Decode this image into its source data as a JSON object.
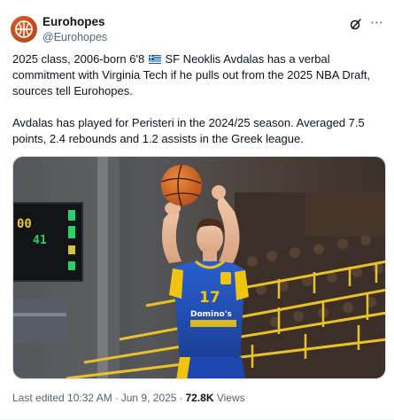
{
  "account": {
    "display_name": "Eurohopes",
    "handle": "@Eurohopes"
  },
  "icons": {
    "avatar": "basketball-logo",
    "grok": "grok-icon",
    "more": "more-options-icon"
  },
  "tweet": {
    "line1_before_flag": "2025 class, 2006-born 6'8",
    "line1_after_flag": "SF Neoklis Avdalas has a verbal commitment with Virginia Tech if he pulls out from the 2025 NBA Draft, sources tell Eurohopes.",
    "paragraph2": "Avdalas has played for Peristeri in the 2024/25 season. Averaged 7.5 points, 2.4 rebounds and 1.2 assists in the Greek league."
  },
  "media": {
    "scoreboard_digits_left": "00",
    "scoreboard_digits_mid": "41",
    "jersey_number": "17",
    "jersey_sponsor": "Domino's"
  },
  "footer": {
    "edited_label": "Last edited 10:32 AM",
    "date": "Jun 9, 2025",
    "views_count": "72.8K",
    "views_label": "Views"
  },
  "colors": {
    "brand_orange": "#c45a26",
    "jersey_yellow": "#f1c40f",
    "jersey_blue": "#1f4fb6",
    "text_secondary": "#536471"
  }
}
